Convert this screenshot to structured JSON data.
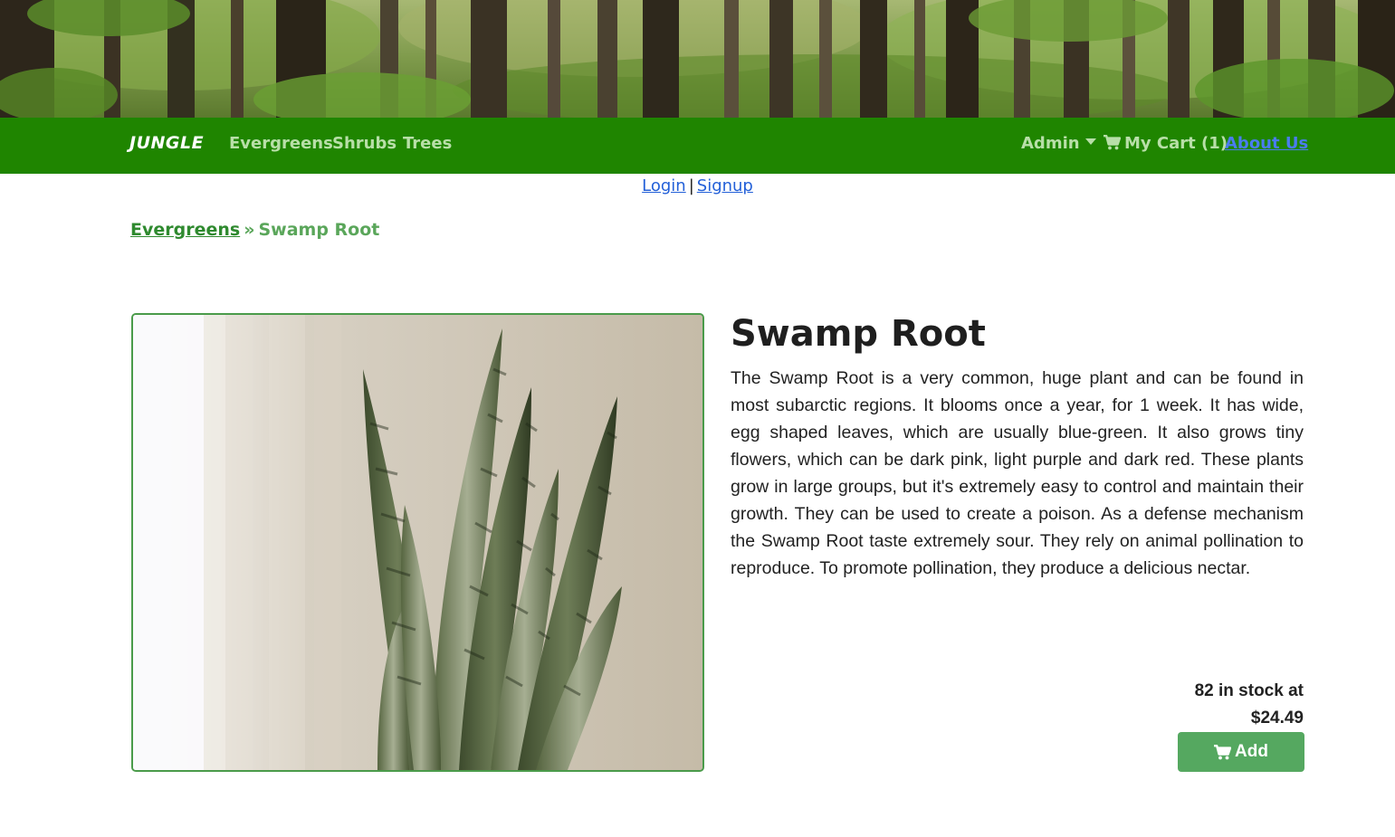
{
  "nav": {
    "brand": "JUNGLE",
    "links": [
      "Evergreens",
      "Shrubs",
      "Trees"
    ],
    "admin_label": "Admin",
    "cart_label": "My Cart (1)",
    "about_label": "About Us"
  },
  "auth": {
    "login": "Login",
    "separator": "|",
    "signup": "Signup"
  },
  "breadcrumb": {
    "category": "Evergreens",
    "separator": "»",
    "current": "Swamp Root"
  },
  "product": {
    "name": "Swamp Root",
    "description": "The Swamp Root is a very common, huge plant and can be found in most subarctic regions. It blooms once a year, for 1 week. It has wide, egg shaped leaves, which are usually blue-green. It also grows tiny flowers, which can be dark pink, light purple and dark red. These plants grow in large groups, but it's extremely easy to control and maintain their growth. They can be used to create a poison. As a defense mechanism the Swamp Root taste extremely sour. They rely on animal pollination to reproduce. To promote pollination, they produce a delicious nectar.",
    "stock_line": "82 in stock at",
    "price": "$24.49",
    "add_label": "Add"
  },
  "icons": {
    "cart": "shopping-cart-icon",
    "caret": "caret-down-icon"
  },
  "colors": {
    "navbar": "#1f8500",
    "nav_link": "#b8dfa8",
    "accent_green": "#55a860",
    "link_blue": "#2360d8"
  }
}
